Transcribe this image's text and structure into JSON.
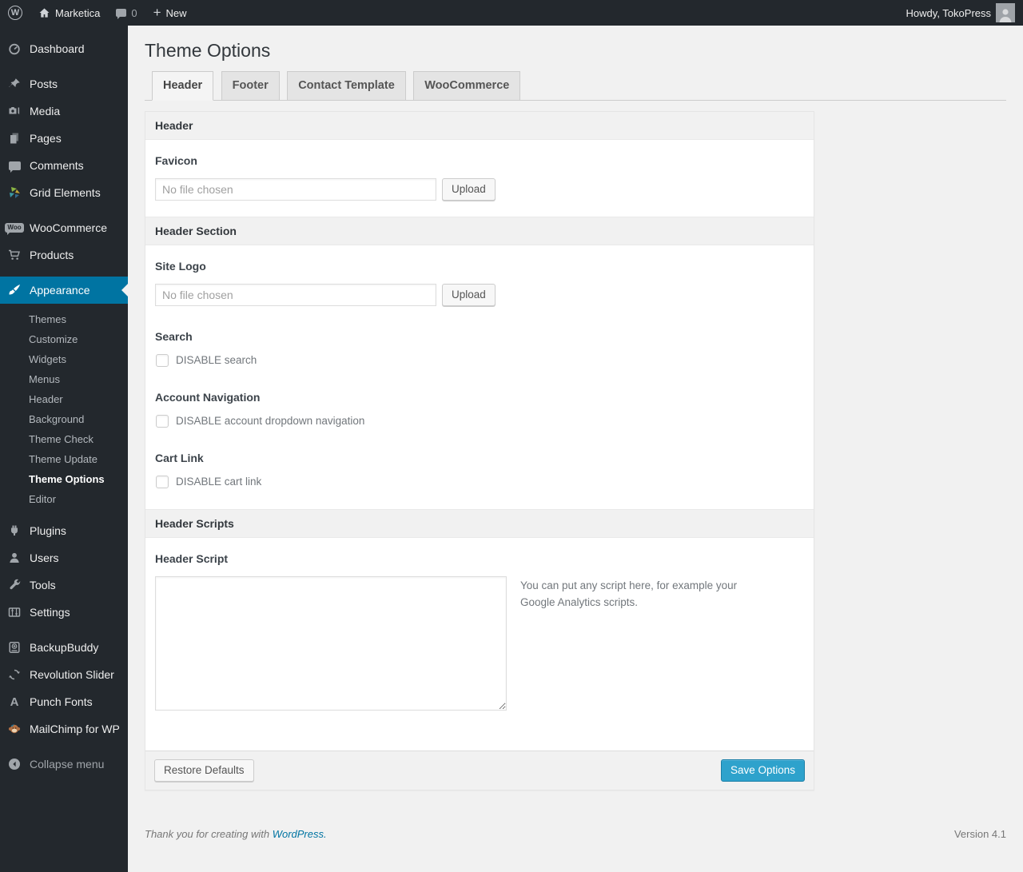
{
  "admin_bar": {
    "wp_logo_glyph": "W",
    "site_name": "Marketica",
    "comment_count": "0",
    "plus_glyph": "+",
    "new_label": "New",
    "howdy": "Howdy, TokoPress"
  },
  "sidebar": {
    "top_items": [
      {
        "label": "Dashboard"
      },
      {
        "label": "Posts"
      },
      {
        "label": "Media"
      },
      {
        "label": "Pages"
      },
      {
        "label": "Comments"
      },
      {
        "label": "Grid Elements"
      },
      {
        "label": "WooCommerce",
        "badge": "Woo"
      },
      {
        "label": "Products"
      }
    ],
    "appearance": {
      "label": "Appearance",
      "submenu": [
        {
          "label": "Themes"
        },
        {
          "label": "Customize"
        },
        {
          "label": "Widgets"
        },
        {
          "label": "Menus"
        },
        {
          "label": "Header"
        },
        {
          "label": "Background"
        },
        {
          "label": "Theme Check"
        },
        {
          "label": "Theme Update"
        },
        {
          "label": "Theme Options",
          "current": true
        },
        {
          "label": "Editor"
        }
      ]
    },
    "bottom_items": [
      {
        "label": "Plugins"
      },
      {
        "label": "Users"
      },
      {
        "label": "Tools"
      },
      {
        "label": "Settings"
      },
      {
        "label": "BackupBuddy"
      },
      {
        "label": "Revolution Slider"
      },
      {
        "label": "Punch Fonts",
        "glyph": "A"
      },
      {
        "label": "MailChimp for WP"
      }
    ],
    "collapse_label": "Collapse menu"
  },
  "page": {
    "title": "Theme Options",
    "tabs": [
      {
        "label": "Header",
        "active": true
      },
      {
        "label": "Footer"
      },
      {
        "label": "Contact Template"
      },
      {
        "label": "WooCommerce"
      }
    ]
  },
  "panel": {
    "section_header_title": "Header",
    "favicon_label": "Favicon",
    "favicon_value": "No file chosen",
    "favicon_upload_label": "Upload",
    "section_header_section_title": "Header Section",
    "site_logo_label": "Site Logo",
    "site_logo_value": "No file chosen",
    "site_logo_upload_label": "Upload",
    "search_label": "Search",
    "search_checkbox_label": "DISABLE search",
    "account_nav_label": "Account Navigation",
    "account_nav_checkbox_label": "DISABLE account dropdown navigation",
    "cart_link_label": "Cart Link",
    "cart_link_checkbox_label": "DISABLE cart link",
    "section_header_scripts_title": "Header Scripts",
    "header_script_label": "Header Script",
    "header_script_value": "",
    "header_script_note": "You can put any script here, for example your Google Analytics scripts.",
    "restore_defaults_label": "Restore Defaults",
    "save_options_label": "Save Options"
  },
  "footer": {
    "thanks_text": "Thank you for creating with",
    "wordpress_link": "WordPress.",
    "version": "Version 4.1"
  },
  "colors": {
    "accent": "#0074a2",
    "primary_button": "#2ea2cc",
    "admin_bg": "#23282d",
    "page_bg": "#f1f1f1"
  }
}
